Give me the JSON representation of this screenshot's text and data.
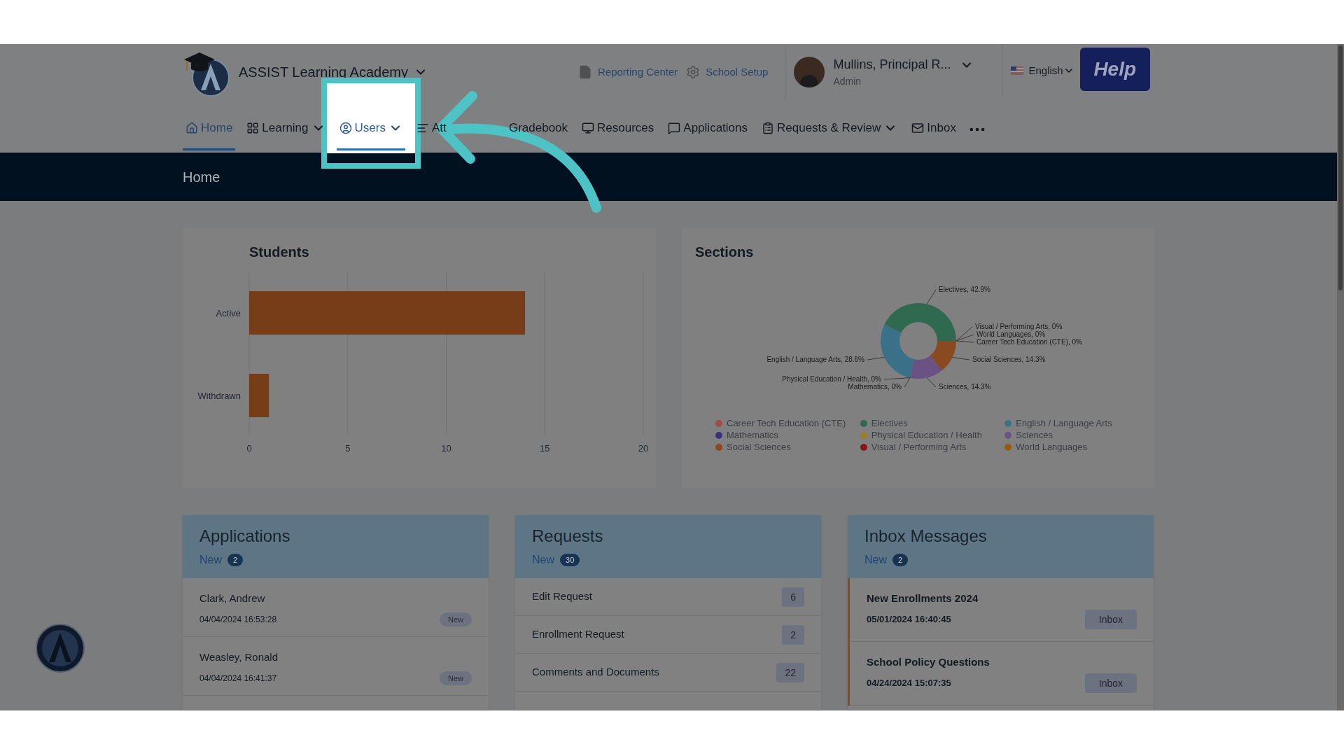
{
  "header": {
    "school_name": "ASSIST Learning Academy",
    "links": [
      "Reporting Center",
      "School Setup"
    ],
    "user": {
      "name": "Mullins, Principal R...",
      "role": "Admin"
    },
    "language": "English",
    "help": "Help"
  },
  "nav": [
    {
      "label": "Home",
      "selected": true,
      "dropdown": false,
      "highlighted": false
    },
    {
      "label": "Learning",
      "selected": false,
      "dropdown": true,
      "highlighted": false
    },
    {
      "label": "Users",
      "selected": false,
      "dropdown": true,
      "highlighted": true
    },
    {
      "label": "Att",
      "selected": false,
      "dropdown": false,
      "highlighted": false
    },
    {
      "label": "Gradebook",
      "selected": false,
      "dropdown": false,
      "highlighted": false
    },
    {
      "label": "Resources",
      "selected": false,
      "dropdown": false,
      "highlighted": false
    },
    {
      "label": "Applications",
      "selected": false,
      "dropdown": false,
      "highlighted": false
    },
    {
      "label": "Requests & Review",
      "selected": false,
      "dropdown": true,
      "highlighted": false
    },
    {
      "label": "Inbox",
      "selected": false,
      "dropdown": false,
      "highlighted": false
    }
  ],
  "page_title": "Home",
  "students": {
    "title": "Students",
    "chart_data": {
      "type": "bar",
      "orientation": "horizontal",
      "categories": [
        "Active",
        "Withdrawn"
      ],
      "series": [
        {
          "color": "#773d19",
          "values": [
            14,
            1
          ]
        }
      ],
      "xlim": [
        0,
        20
      ],
      "xticks": [
        0,
        5,
        10,
        15,
        20
      ],
      "grid": true
    }
  },
  "sections": {
    "title": "Sections",
    "chart_data": {
      "type": "donut",
      "categories": [
        "Career Tech Education (CTE)",
        "Electives",
        "English / Language Arts",
        "Mathematics",
        "Physical Education / Health",
        "Sciences",
        "Social Sciences",
        "Visual / Performing Arts",
        "World Languages"
      ],
      "series": [
        {
          "colors": [
            "#a04a4a",
            "#2f6a50",
            "#3a7088",
            "#35357a",
            "#9c7c2a",
            "#6a5285",
            "#8a4a20",
            "#8a1515",
            "#9a5a10"
          ],
          "values": [
            0,
            42.9,
            28.6,
            0,
            0,
            14.3,
            14.3,
            0,
            0
          ]
        }
      ],
      "value_labels": [
        "Career Tech Education (CTE), 0%",
        "Electives, 42.9%",
        "English / Language Arts, 28.6%",
        "Mathematics, 0%",
        "Physical Education / Health, 0%",
        "Sciences, 14.3%",
        "Social Sciences, 14.3%",
        "Visual / Performing Arts, 0%",
        "World Languages, 0%"
      ]
    }
  },
  "applications": {
    "title": "Applications",
    "new_label": "New",
    "new_count": "2",
    "items": [
      {
        "name": "Clark, Andrew",
        "date": "04/04/2024 16:53:28",
        "badge": "New"
      },
      {
        "name": "Weasley, Ronald",
        "date": "04/04/2024 16:41:37",
        "badge": "New"
      }
    ]
  },
  "requests": {
    "title": "Requests",
    "new_label": "New",
    "new_count": "30",
    "items": [
      {
        "name": "Edit Request",
        "count": "6"
      },
      {
        "name": "Enrollment Request",
        "count": "2"
      },
      {
        "name": "Comments and Documents",
        "count": "22"
      }
    ]
  },
  "inbox": {
    "title": "Inbox Messages",
    "new_label": "New",
    "new_count": "2",
    "items": [
      {
        "subject": "New Enrollments 2024",
        "date": "05/01/2024 16:40:45",
        "button": "Inbox"
      },
      {
        "subject": "School Policy Questions",
        "date": "04/24/2024 15:07:35",
        "button": "Inbox"
      }
    ]
  }
}
